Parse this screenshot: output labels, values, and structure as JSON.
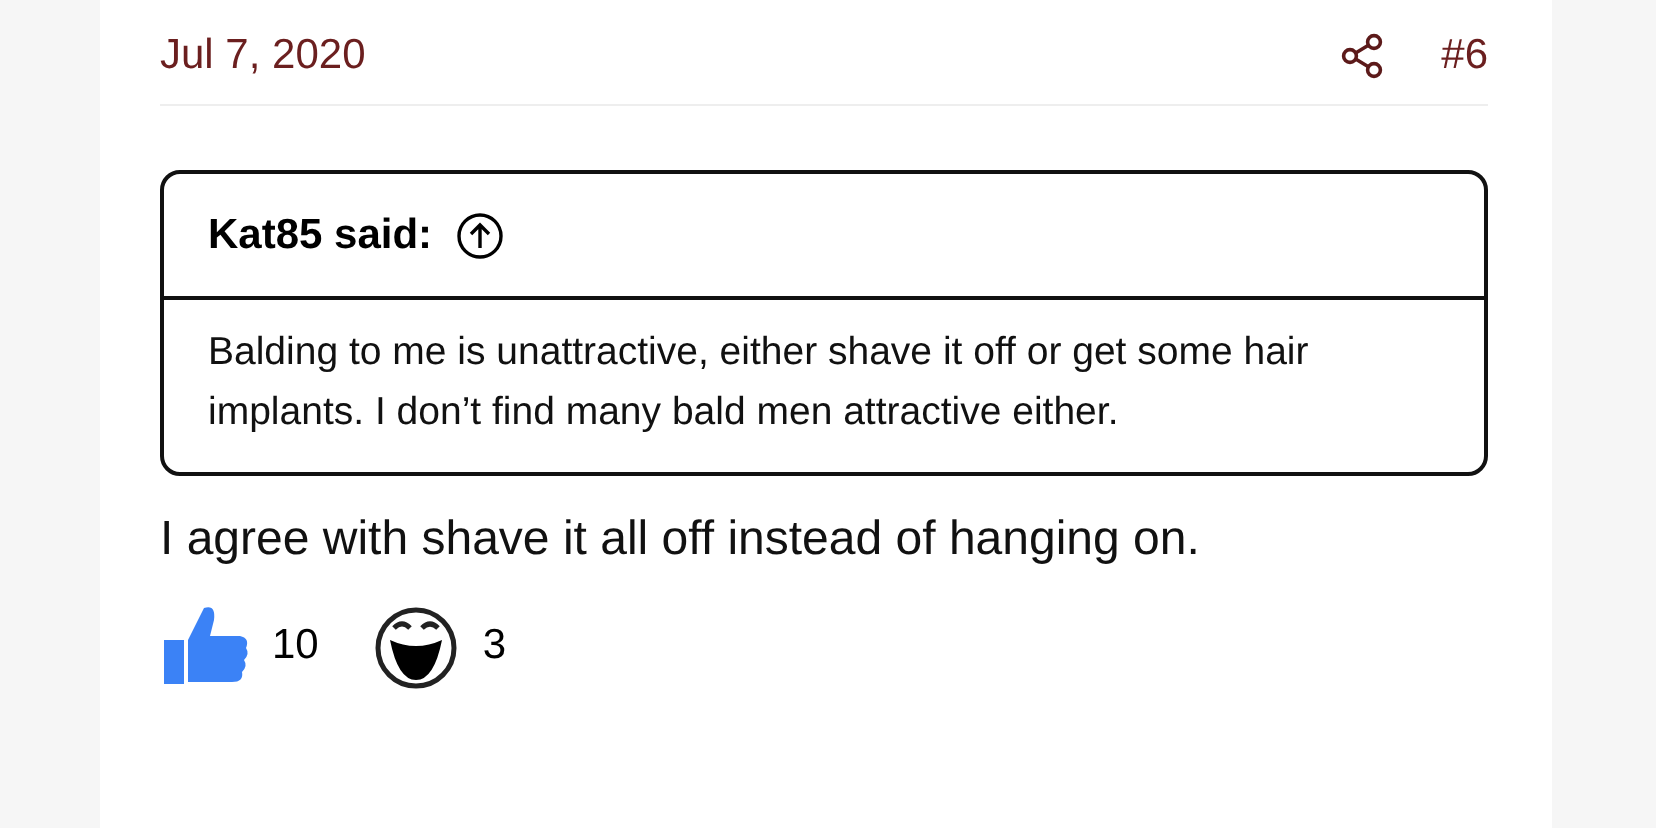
{
  "post": {
    "date": "Jul 7, 2020",
    "number": "#6"
  },
  "quote": {
    "author": "Kat85 said:",
    "text": "Balding to me is unattractive, either shave it off or get some hair implants. I don’t find many bald men attractive either."
  },
  "message": "I agree with shave it all off instead of hanging on.",
  "reactions": [
    {
      "kind": "like",
      "count": "10"
    },
    {
      "kind": "haha",
      "count": "3"
    }
  ]
}
